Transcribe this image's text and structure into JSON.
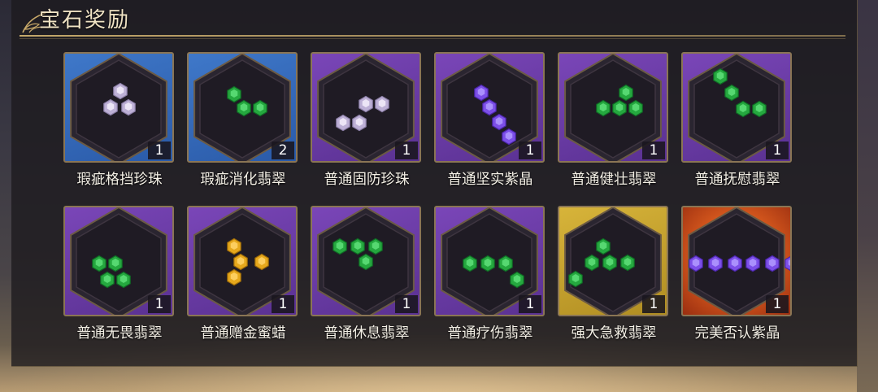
{
  "title": "宝石奖励",
  "colors": {
    "blue": "#3f78c9",
    "purple": "#7a46b8",
    "gold": "#d7b43a",
    "orange": "#d0541c",
    "pearl": "#d9ccea",
    "emerald": "#33b84c",
    "amethyst": "#7c4fe8",
    "amber": "#e6a81c"
  },
  "items": [
    {
      "name": "瑕疵格挡珍珠",
      "count": "1",
      "bg": "blue",
      "gem": "pearl",
      "icon": "pearl-gems-icon"
    },
    {
      "name": "瑕疵消化翡翠",
      "count": "2",
      "bg": "blue",
      "gem": "emerald",
      "icon": "emerald-gems-icon"
    },
    {
      "name": "普通固防珍珠",
      "count": "1",
      "bg": "purple",
      "gem": "pearl",
      "icon": "pearl-gems-icon"
    },
    {
      "name": "普通坚实紫晶",
      "count": "1",
      "bg": "purple",
      "gem": "amethyst",
      "icon": "amethyst-gems-icon"
    },
    {
      "name": "普通健壮翡翠",
      "count": "1",
      "bg": "purple",
      "gem": "emerald",
      "icon": "emerald-gems-icon"
    },
    {
      "name": "普通抚慰翡翠",
      "count": "1",
      "bg": "purple",
      "gem": "emerald",
      "icon": "emerald-gems-icon"
    },
    {
      "name": "普通无畏翡翠",
      "count": "1",
      "bg": "purple",
      "gem": "emerald",
      "icon": "emerald-gems-icon"
    },
    {
      "name": "普通赠金蜜蜡",
      "count": "1",
      "bg": "purple",
      "gem": "amber",
      "icon": "amber-gems-icon"
    },
    {
      "name": "普通休息翡翠",
      "count": "1",
      "bg": "purple",
      "gem": "emerald",
      "icon": "emerald-gems-icon"
    },
    {
      "name": "普通疗伤翡翠",
      "count": "1",
      "bg": "purple",
      "gem": "emerald",
      "icon": "emerald-gems-icon"
    },
    {
      "name": "强大急救翡翠",
      "count": "1",
      "bg": "gold",
      "gem": "emerald",
      "icon": "emerald-gems-icon"
    },
    {
      "name": "完美否认紫晶",
      "count": "1",
      "bg": "orange",
      "gem": "amethyst",
      "icon": "amethyst-gems-icon"
    }
  ]
}
